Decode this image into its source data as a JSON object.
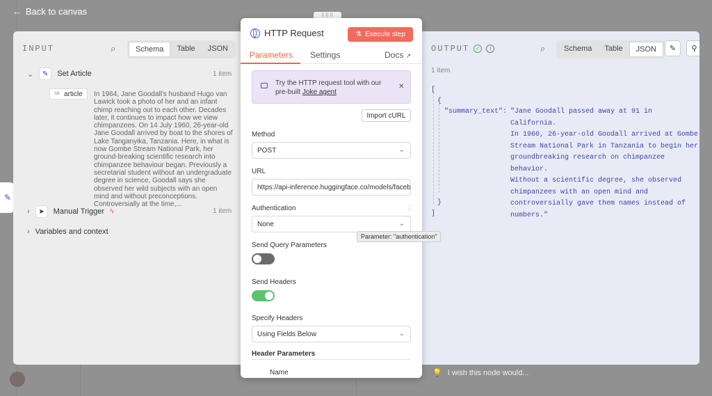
{
  "back_label": "Back to canvas",
  "input": {
    "title": "INPUT",
    "tabs": [
      "Schema",
      "Table",
      "JSON"
    ],
    "active_tab": "Schema",
    "set_article": {
      "label": "Set Article",
      "count": "1 item"
    },
    "field_type": "AB",
    "field_name": "article",
    "article_text": "In 1964, Jane Goodall's husband Hugo van Lawick took a photo of her and an infant chimp reaching out to each other. Decades later, it continues to impact how we view chimpanzees. On 14 July 1960, 26-year-old Jane Goodall arrived by boat to the shores of Lake Tanganyika, Tanzania. Here, in what is now Gombe Stream National Park, her ground-breaking scientific research into chimpanzee behaviour began. Previously a secretarial student without an undergraduate degree in science, Goodall says she observed her wild subjects with an open mind and without preconceptions. Controversially at the time,...",
    "manual_trigger": {
      "label": "Manual Trigger",
      "count": "1 item"
    },
    "variables_label": "Variables and context"
  },
  "output": {
    "title": "OUTPUT",
    "tabs": [
      "Schema",
      "Table",
      "JSON"
    ],
    "active_tab": "JSON",
    "count": "1 item",
    "json": {
      "open_bracket": "[",
      "open_brace": "{",
      "key": "\"summary_text\":",
      "value_lines": [
        "\"Jane Goodall passed away at 91 in California.",
        "In 1960, 26-year-old Goodall arrived at Gombe",
        "Stream National Park in Tanzania to begin her",
        "groundbreaking research on chimpanzee behavior.",
        "Without a scientific degree, she observed",
        "chimpanzees with an open mind and",
        "controversially gave them names instead of",
        "numbers.\""
      ],
      "close_brace": "}",
      "close_bracket": "]"
    }
  },
  "node": {
    "title": "HTTP Request",
    "execute_label": "Execute step",
    "tabs": {
      "parameters": "Parameters",
      "settings": "Settings",
      "docs": "Docs"
    },
    "banner_text": "Try the HTTP request tool with our pre-built",
    "banner_link": "Joke agent",
    "import_label": "Import cURL",
    "method_label": "Method",
    "method_value": "POST",
    "url_label": "URL",
    "url_value": "https://api-inference.huggingface.co/models/facebook/bart-large-cnn",
    "auth_label": "Authentication",
    "auth_value": "None",
    "send_query_label": "Send Query Parameters",
    "send_query_on": false,
    "send_headers_label": "Send Headers",
    "send_headers_on": true,
    "specify_headers_label": "Specify Headers",
    "specify_headers_value": "Using Fields Below",
    "header_params_label": "Header Parameters",
    "name_label": "Name",
    "tooltip": "Parameter: \"authentication\""
  },
  "wish_text": "I wish this node would...",
  "colors": {
    "accent": "#f26a5d",
    "toggle_on": "#5cc36b",
    "toggle_off": "#6b6b6b",
    "json_value": "#3d45a8"
  }
}
